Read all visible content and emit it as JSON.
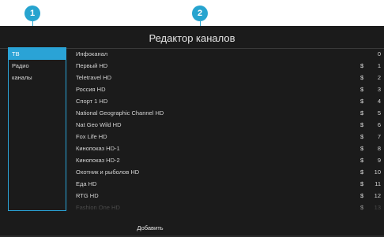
{
  "callouts": [
    "1",
    "2"
  ],
  "header": {
    "title": "Редактор каналов"
  },
  "sidebar": {
    "items": [
      {
        "label": "ТВ"
      },
      {
        "label": "Радио"
      },
      {
        "label": "каналы"
      }
    ],
    "active_index": 0
  },
  "channels": [
    {
      "name": "Инфоканал",
      "cost": "",
      "number": "0"
    },
    {
      "name": "Первый HD",
      "cost": "$",
      "number": "1"
    },
    {
      "name": "Teletravel HD",
      "cost": "$",
      "number": "2"
    },
    {
      "name": "Россия HD",
      "cost": "$",
      "number": "3"
    },
    {
      "name": "Спорт 1 HD",
      "cost": "$",
      "number": "4"
    },
    {
      "name": "National Geographic Channel HD",
      "cost": "$",
      "number": "5"
    },
    {
      "name": "Nat Geo Wild HD",
      "cost": "$",
      "number": "6"
    },
    {
      "name": "Fox Life HD",
      "cost": "$",
      "number": "7"
    },
    {
      "name": "Кинопоказ HD-1",
      "cost": "$",
      "number": "8"
    },
    {
      "name": "Кинопоказ HD-2",
      "cost": "$",
      "number": "9"
    },
    {
      "name": "Охотник и рыболов HD",
      "cost": "$",
      "number": "10"
    },
    {
      "name": "Еда HD",
      "cost": "$",
      "number": "11"
    },
    {
      "name": "RTG HD",
      "cost": "$",
      "number": "12"
    },
    {
      "name": "Fashion One HD",
      "cost": "$",
      "number": "13"
    }
  ],
  "actions": {
    "add_label": "Добавить"
  },
  "colors": {
    "accent": "#2aa3d6",
    "callout": "#27a4cf",
    "add_button": "#2fa54a",
    "background": "#1b1b1b"
  }
}
